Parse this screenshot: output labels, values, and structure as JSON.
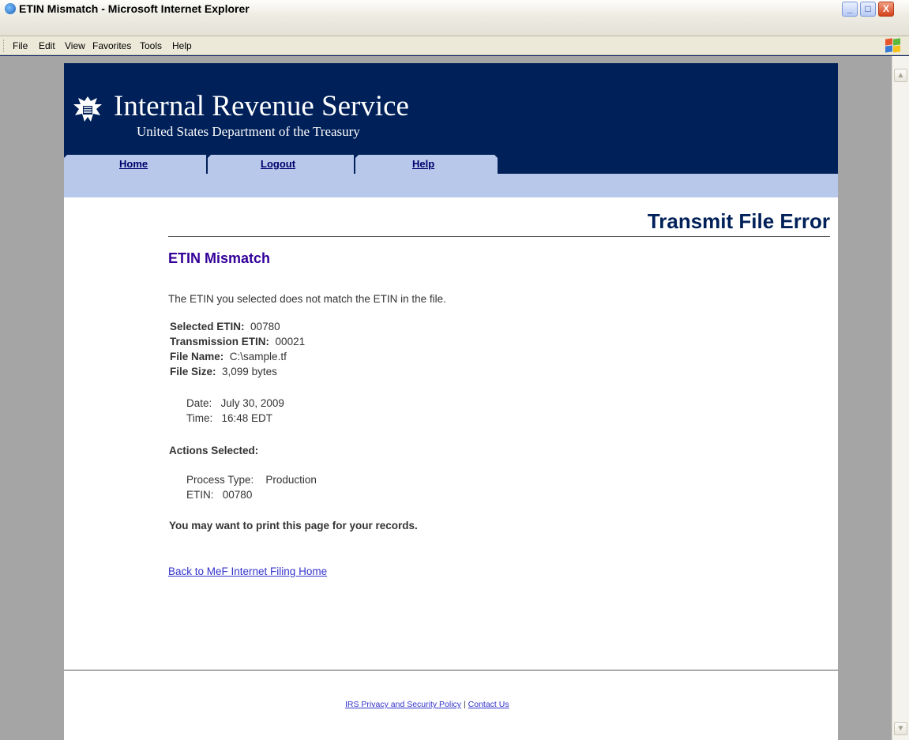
{
  "window": {
    "title": "ETIN Mismatch - Microsoft Internet Explorer",
    "minimize": "_",
    "maximize": "□",
    "close": "X"
  },
  "menu": {
    "items": [
      {
        "label": "File",
        "accel": "F"
      },
      {
        "label": "Edit",
        "accel": "E"
      },
      {
        "label": "View",
        "accel": "V"
      },
      {
        "label": "Favorites",
        "accel": "a"
      },
      {
        "label": "Tools",
        "accel": "T"
      },
      {
        "label": "Help",
        "accel": "H"
      }
    ]
  },
  "header": {
    "org_name": "Internal Revenue Service",
    "org_sub": "United States Department of the Treasury",
    "tabs": [
      {
        "label": "Home"
      },
      {
        "label": "Logout"
      },
      {
        "label": "Help"
      }
    ]
  },
  "main": {
    "page_title": "Transmit File Error",
    "section_title": "ETIN Mismatch",
    "message": "The ETIN you selected does not match the ETIN in the file.",
    "details": {
      "selected_etin_label": "Selected ETIN:",
      "selected_etin_value": "00780",
      "transmission_etin_label": "Transmission ETIN:",
      "transmission_etin_value": "00021",
      "file_name_label": "File Name:",
      "file_name_value": "C:\\sample.tf",
      "file_size_label": "File Size:",
      "file_size_value": "3,099 bytes"
    },
    "date_label": "Date:",
    "date_value": "July 30, 2009",
    "time_label": "Time:",
    "time_value": "16:48 EDT",
    "actions_label": "Actions Selected:",
    "process_type_label": "Process Type:",
    "process_type_value": "Production",
    "etin_label": "ETIN:",
    "etin_value": "00780",
    "print_notice": "You may want to print this page for your records.",
    "back_link": "Back to MeF Internet Filing Home"
  },
  "footer": {
    "privacy_link": "IRS Privacy and Security Policy",
    "separator": "|",
    "contact_link": "Contact Us"
  },
  "colors": {
    "header_bg": "#002059",
    "tab_bg": "#b8c8eb",
    "section_title": "#330099",
    "link": "#3333cc"
  }
}
